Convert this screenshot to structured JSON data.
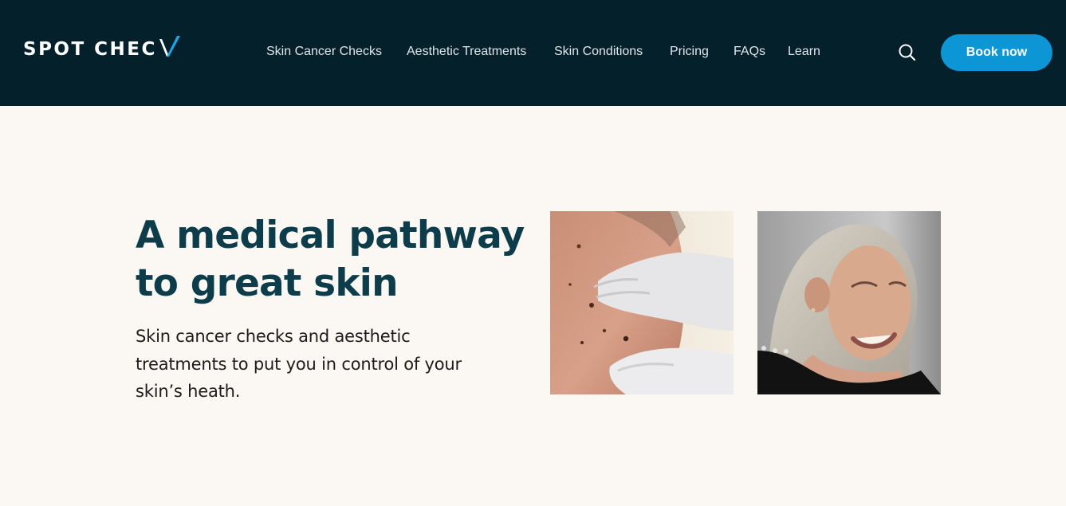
{
  "brand": {
    "name": "SPOT CHEC"
  },
  "nav": {
    "items": [
      {
        "label": "Skin Cancer Checks"
      },
      {
        "label": "Aesthetic Treatments"
      },
      {
        "label": "Skin Conditions"
      },
      {
        "label": "Pricing"
      },
      {
        "label": "FAQs"
      },
      {
        "label": "Learn"
      }
    ],
    "search_icon": "search-icon",
    "book_label": "Book now"
  },
  "hero": {
    "heading_line1": "A medical pathway",
    "heading_line2": "to great skin",
    "sub_line1": "Skin cancer checks and aesthetic",
    "sub_line2": "treatments to put you in control of your",
    "sub_line3": "skin’s heath."
  },
  "colors": {
    "nav_background": "#04202b",
    "page_background": "#fbf8f3",
    "accent": "#0d96d6",
    "heading": "#0d3d4b"
  }
}
